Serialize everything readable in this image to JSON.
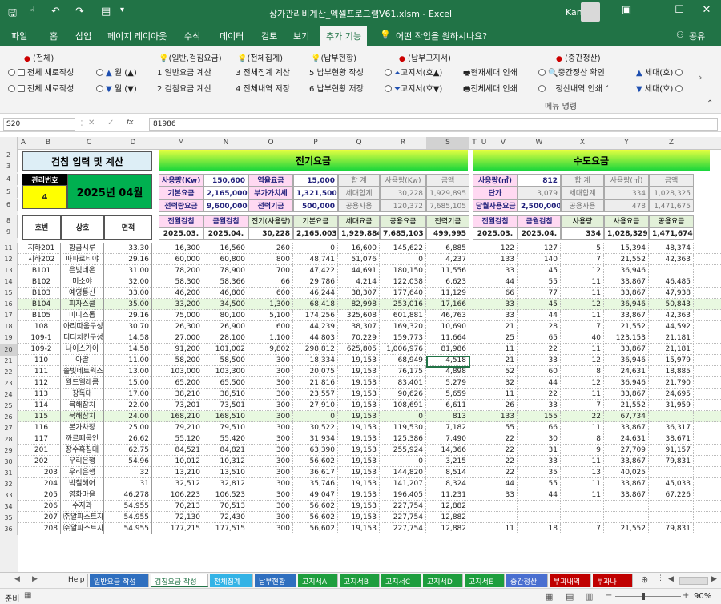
{
  "window": {
    "title": "상가관리비계산_엑셀프로그램V61.xlsm  -  Excel",
    "user": "Kangha",
    "quick_access": [
      "save-icon",
      "touch-icon",
      "undo-icon",
      "redo-icon",
      "format-icon",
      "customize-icon"
    ]
  },
  "ribbon_tabs": [
    "파일",
    "홈",
    "삽입",
    "페이지 레이아웃",
    "수식",
    "데이터",
    "검토",
    "보기",
    "추가 기능"
  ],
  "tell_me": "어떤 작업을 원하시나요?",
  "share": "공유",
  "ribbon": {
    "groups": [
      {
        "title": "(전체)",
        "items": [
          "전체 새로작성",
          "전체 새로작성"
        ]
      },
      {
        "title": "(일반,검침요금)",
        "items": [
          "1  일반요금 계산",
          "2  검침요금 계산"
        ]
      },
      {
        "title": "(전체집계)",
        "items": [
          "3  전체집계 계산",
          "4  전체내역 저장"
        ]
      },
      {
        "title": "(납부현황)",
        "items": [
          "5  납부현황 작성",
          "6  납부현황 저장"
        ]
      },
      {
        "title": "(납부고지서)",
        "items": [
          "고지서(호▲)",
          "고지서(호▼)"
        ]
      },
      {
        "title": "",
        "items": [
          "현재세대 인쇄",
          "전체세대 인쇄"
        ]
      },
      {
        "title": "(중간정산)",
        "items": [
          "중간정산 확인",
          "정산내역 인쇄"
        ]
      },
      {
        "title": "",
        "items": [
          "세대(호)",
          "세대(호)"
        ]
      }
    ],
    "month_up": "월 (▲)",
    "month_down": "월 (▼)",
    "footer": "메뉴 명령"
  },
  "formula_bar": {
    "name_box": "S20",
    "value": "81986",
    "fx": "fx"
  },
  "columns": [
    "A",
    "B",
    "C",
    "D",
    "M",
    "N",
    "O",
    "P",
    "Q",
    "R",
    "S",
    "T",
    "U",
    "V",
    "W",
    "X",
    "Y",
    "Z"
  ],
  "sheet": {
    "title_left": "검침 입력 및 계산",
    "elec_title": "전기요금",
    "water_title": "수도요금",
    "mgmt_no_label": "관리번호",
    "mgmt_no": "4",
    "period": "2025년 04월",
    "elec_info": [
      [
        "사용량(Kw)",
        "150,600",
        "역율요금",
        "15,000",
        "합  계",
        "사용량(Kw)",
        "금액"
      ],
      [
        "기본요금",
        "2,165,000",
        "부가가치세",
        "1,321,500",
        "세대합계",
        "30,228",
        "1,929,895"
      ],
      [
        "전력량요금",
        "9,600,000",
        "전력기금",
        "500,000",
        "공용사용",
        "120,372",
        "7,685,105"
      ]
    ],
    "water_info": [
      [
        "사용량(㎥)",
        "812",
        "합  계",
        "사용량(㎥)",
        "금액"
      ],
      [
        "단가",
        "3,079",
        "세대합계",
        "334",
        "1,028,325"
      ],
      [
        "당월사용요금",
        "2,500,000",
        "공용사용",
        "478",
        "1,471,675"
      ]
    ],
    "headers_left": [
      "호번",
      "상호",
      "면적"
    ],
    "headers_elec": [
      "전월검침",
      "금월검침",
      "전기(사용량)",
      "기본요금",
      "세대요금",
      "공용요금",
      "전력기금"
    ],
    "headers_water": [
      "전월검침",
      "금월검침",
      "사용량",
      "사용요금",
      "공용요금"
    ],
    "totals_elec": [
      "2025.03.",
      "2025.04.",
      "30,228",
      "2,165,003",
      "1,929,884",
      "7,685,103",
      "499,995"
    ],
    "totals_water": [
      "2025.03.",
      "2025.04.",
      "334",
      "1,028,329",
      "1,471,674"
    ],
    "row_numbers": [
      "2",
      "3",
      "4",
      "5",
      "6",
      "8",
      "9",
      "11",
      "12",
      "13",
      "14",
      "15",
      "16",
      "17",
      "18",
      "19",
      "20",
      "21",
      "22",
      "23",
      "24",
      "25",
      "26",
      "27",
      "28",
      "29",
      "30",
      "31",
      "32",
      "33",
      "34",
      "35",
      "36"
    ],
    "rows": [
      [
        "지하201",
        "황금시루",
        "33.30",
        "16,300",
        "16,560",
        "260",
        "0",
        "16,600",
        "145,622",
        "6,885",
        "122",
        "127",
        "5",
        "15,394",
        "48,374"
      ],
      [
        "지하202",
        "파파로티야",
        "29.16",
        "60,000",
        "60,800",
        "800",
        "48,741",
        "51,076",
        "0",
        "4,237",
        "133",
        "140",
        "7",
        "21,552",
        "42,363"
      ],
      [
        "B101",
        "은빛네온",
        "31.00",
        "78,200",
        "78,900",
        "700",
        "47,422",
        "44,691",
        "180,150",
        "11,556",
        "33",
        "45",
        "12",
        "36,946",
        ""
      ],
      [
        "B102",
        "미소야",
        "32.00",
        "58,300",
        "58,366",
        "66",
        "29,786",
        "4,214",
        "122,038",
        "6,623",
        "44",
        "55",
        "11",
        "33,867",
        "46,485"
      ],
      [
        "B103",
        "예영통신",
        "33.00",
        "46,200",
        "46,800",
        "600",
        "46,244",
        "38,307",
        "177,640",
        "11,129",
        "66",
        "77",
        "11",
        "33,867",
        "47,938"
      ],
      [
        "B104",
        "피자스쿨",
        "35.00",
        "33,200",
        "34,500",
        "1,300",
        "68,418",
        "82,998",
        "253,016",
        "17,166",
        "33",
        "45",
        "12",
        "36,946",
        "50,843"
      ],
      [
        "B105",
        "미니스톱",
        "29.16",
        "75,000",
        "80,100",
        "5,100",
        "174,256",
        "325,608",
        "601,881",
        "46,763",
        "33",
        "44",
        "11",
        "33,867",
        "42,363"
      ],
      [
        "108",
        "아리따움구성",
        "30.70",
        "26,300",
        "26,900",
        "600",
        "44,239",
        "38,307",
        "169,320",
        "10,690",
        "21",
        "28",
        "7",
        "21,552",
        "44,592"
      ],
      [
        "109-1",
        "디디치킨구성",
        "14.58",
        "27,000",
        "28,100",
        "1,100",
        "44,803",
        "70,229",
        "159,773",
        "11,664",
        "25",
        "65",
        "40",
        "123,153",
        "21,181"
      ],
      [
        "109-2",
        "나이스가이",
        "14.58",
        "91,200",
        "101,002",
        "9,802",
        "298,812",
        "625,805",
        "1,006,976",
        "81,986",
        "11",
        "22",
        "11",
        "33,867",
        "21,181"
      ],
      [
        "110",
        "아딸",
        "11.00",
        "58,200",
        "58,500",
        "300",
        "18,334",
        "19,153",
        "68,949",
        "4,518",
        "21",
        "33",
        "12",
        "36,946",
        "15,979"
      ],
      [
        "111",
        "솔빛네트웍스",
        "13.00",
        "103,000",
        "103,300",
        "300",
        "20,075",
        "19,153",
        "76,175",
        "4,898",
        "52",
        "60",
        "8",
        "24,631",
        "18,885"
      ],
      [
        "112",
        "월드웰레콤",
        "15.00",
        "65,200",
        "65,500",
        "300",
        "21,816",
        "19,153",
        "83,401",
        "5,279",
        "32",
        "44",
        "12",
        "36,946",
        "21,790"
      ],
      [
        "113",
        "장독대",
        "17.00",
        "38,210",
        "38,510",
        "300",
        "23,557",
        "19,153",
        "90,626",
        "5,659",
        "11",
        "22",
        "11",
        "33,867",
        "24,695"
      ],
      [
        "114",
        "북해참치",
        "22.00",
        "73,201",
        "73,501",
        "300",
        "27,910",
        "19,153",
        "108,691",
        "6,611",
        "26",
        "33",
        "7",
        "21,552",
        "31,959"
      ],
      [
        "115",
        "북해참치",
        "24.00",
        "168,210",
        "168,510",
        "300",
        "0",
        "19,153",
        "0",
        "813",
        "133",
        "155",
        "22",
        "67,734",
        ""
      ],
      [
        "116",
        "본가차장",
        "25.00",
        "79,210",
        "79,510",
        "300",
        "30,522",
        "19,153",
        "119,530",
        "7,182",
        "55",
        "66",
        "11",
        "33,867",
        "36,317"
      ],
      [
        "117",
        "까르페몽인",
        "26.62",
        "55,120",
        "55,420",
        "300",
        "31,934",
        "19,153",
        "125,386",
        "7,490",
        "22",
        "30",
        "8",
        "24,631",
        "38,671"
      ],
      [
        "201",
        "장수흑침대",
        "62.75",
        "84,521",
        "84,821",
        "300",
        "63,390",
        "19,153",
        "255,924",
        "14,366",
        "22",
        "31",
        "9",
        "27,709",
        "91,157"
      ],
      [
        "202",
        "우리은행",
        "54.96",
        "10,012",
        "10,312",
        "300",
        "56,602",
        "19,153",
        "0",
        "3,215",
        "22",
        "33",
        "11",
        "33,867",
        "79,831"
      ],
      [
        "203",
        "우리은행",
        "32",
        "13,210",
        "13,510",
        "300",
        "36,617",
        "19,153",
        "144,820",
        "8,514",
        "22",
        "35",
        "13",
        "40,025",
        ""
      ],
      [
        "204",
        "박철헤어",
        "31",
        "32,512",
        "32,812",
        "300",
        "35,746",
        "19,153",
        "141,207",
        "8,324",
        "44",
        "55",
        "11",
        "33,867",
        "45,033"
      ],
      [
        "205",
        "영화마을",
        "46.278",
        "106,223",
        "106,523",
        "300",
        "49,047",
        "19,153",
        "196,405",
        "11,231",
        "33",
        "44",
        "11",
        "33,867",
        "67,226"
      ],
      [
        "206",
        "수지과",
        "54.955",
        "70,213",
        "70,513",
        "300",
        "56,602",
        "19,153",
        "227,754",
        "12,882",
        "",
        "",
        "",
        "",
        ""
      ],
      [
        "207",
        "㈜알파스트자",
        "54.955",
        "72,130",
        "72,430",
        "300",
        "56,602",
        "19,153",
        "227,754",
        "12,882",
        "",
        "",
        "",
        "",
        ""
      ],
      [
        "208",
        "㈜알파스트자",
        "54.955",
        "177,215",
        "177,515",
        "300",
        "56,602",
        "19,153",
        "227,754",
        "12,882",
        "11",
        "18",
        "7",
        "21,552",
        "79,831"
      ]
    ]
  },
  "sheet_tabs": [
    "Help",
    "일반요금 작성",
    "검침요금 작성",
    "전체집계",
    "납부현황",
    "고지서A",
    "고지서B",
    "고지서C",
    "고지서D",
    "고지서E",
    "중간정산",
    "부과내역",
    "부과나"
  ],
  "sheet_tab_colors": [
    "#f3f3f3",
    "#2f6fbf",
    "#f3f3f3",
    "#33b3e6",
    "#2f6fbf",
    "#1e9e3e",
    "#1e9e3e",
    "#1e9e3e",
    "#1e9e3e",
    "#1e9e3e",
    "#4a6fd0",
    "#c00000",
    "#c00000"
  ],
  "status": {
    "ready": "준비",
    "zoom": "90%"
  }
}
